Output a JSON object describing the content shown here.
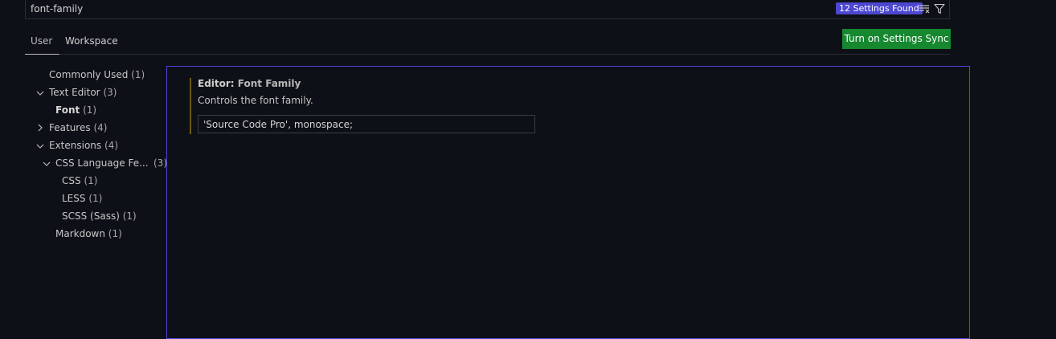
{
  "search": {
    "value": "font-family",
    "results_badge": "12 Settings Found"
  },
  "tabs": [
    {
      "label": "User"
    },
    {
      "label": "Workspace"
    }
  ],
  "sync_button": "Turn on Settings Sync",
  "toc": [
    {
      "label": "Commonly Used",
      "count": "(1)"
    },
    {
      "label": "Text Editor",
      "count": "(3)"
    },
    {
      "label": "Font",
      "count": "(1)"
    },
    {
      "label": "Features",
      "count": "(4)"
    },
    {
      "label": "Extensions",
      "count": "(4)"
    },
    {
      "label": "CSS Language Fe...",
      "count": "(3)"
    },
    {
      "label": "CSS",
      "count": "(1)"
    },
    {
      "label": "LESS",
      "count": "(1)"
    },
    {
      "label": "SCSS (Sass)",
      "count": "(1)"
    },
    {
      "label": "Markdown",
      "count": "(1)"
    }
  ],
  "setting": {
    "category": "Editor: ",
    "name": "Font Family",
    "description": "Controls the font family.",
    "value": "'Source Code Pro', monospace;"
  },
  "colors": {
    "background": "#0e1017",
    "badge": "#4d47d1",
    "sync_button": "#16882f",
    "focus_border": "#4f47e0",
    "modified_indicator": "#6a5a12"
  }
}
